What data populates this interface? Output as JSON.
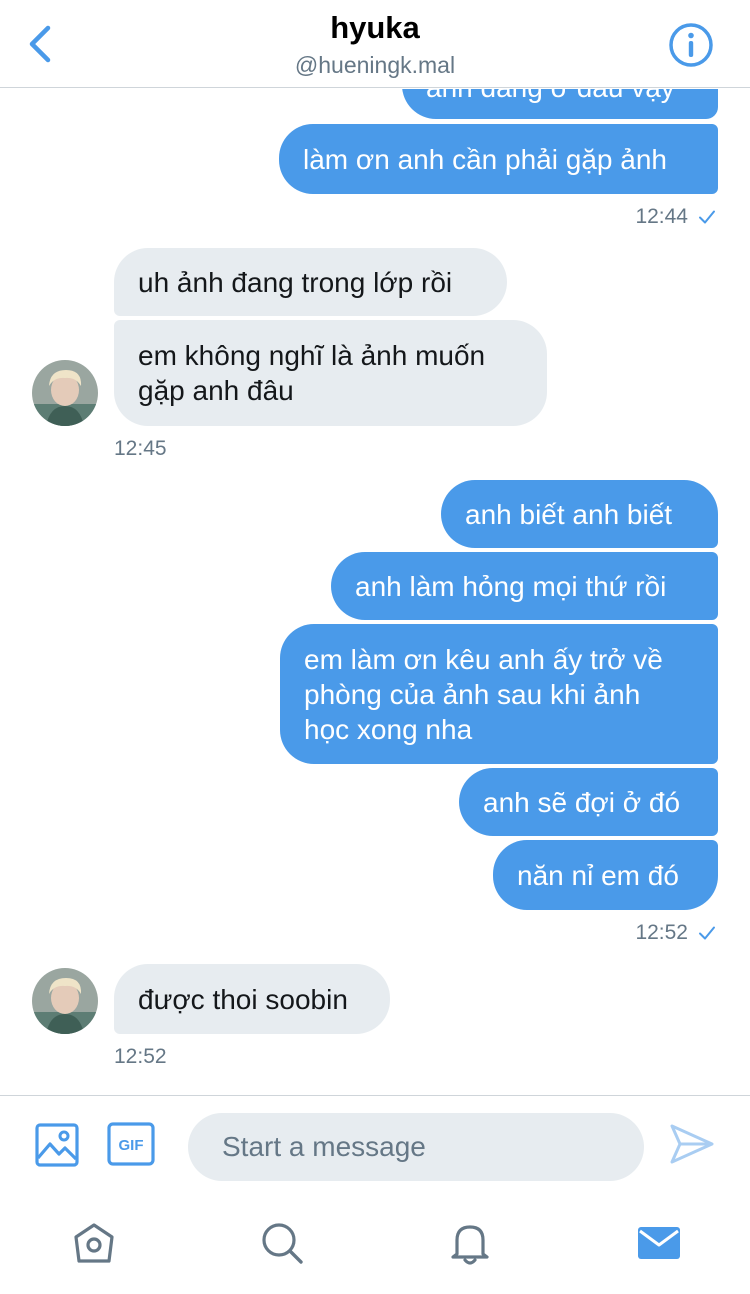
{
  "header": {
    "title": "hyuka",
    "handle": "@hueningk.mal"
  },
  "thread": {
    "partial_message": "anh đang ở đâu vậy",
    "msg_1": "làm ơn anh cần phải gặp ảnh",
    "time_1": "12:44",
    "msg_2": "uh ảnh đang trong lớp rồi",
    "msg_3_line1": "em không nghĩ là ảnh muốn",
    "msg_3_line2": "gặp anh đâu",
    "time_2": "12:45",
    "msg_4": "anh biết anh biết",
    "msg_5": "anh làm hỏng mọi thứ rồi",
    "msg_6_line1": "em làm ơn kêu anh ấy trở về",
    "msg_6_line2": "phòng của ảnh sau khi ảnh",
    "msg_6_line3": "học xong nha",
    "msg_7": "anh sẽ đợi ở đó",
    "msg_8": "năn nỉ em đó",
    "time_3": "12:52",
    "msg_9": "được thoi soobin",
    "time_4": "12:52"
  },
  "composer": {
    "placeholder": "Start a message",
    "gif_label": "GIF"
  },
  "icons": {
    "back": "chevron-left-icon",
    "info": "info-icon",
    "media": "image-icon",
    "gif": "gif-icon",
    "send": "send-icon",
    "home": "home-icon",
    "search": "search-icon",
    "notifications": "bell-icon",
    "messages": "mail-icon"
  },
  "colors": {
    "accent": "#4a9ae9",
    "incoming_bubble": "#e7ecf0",
    "muted_text": "#657786",
    "tab_icon": "#657786"
  }
}
